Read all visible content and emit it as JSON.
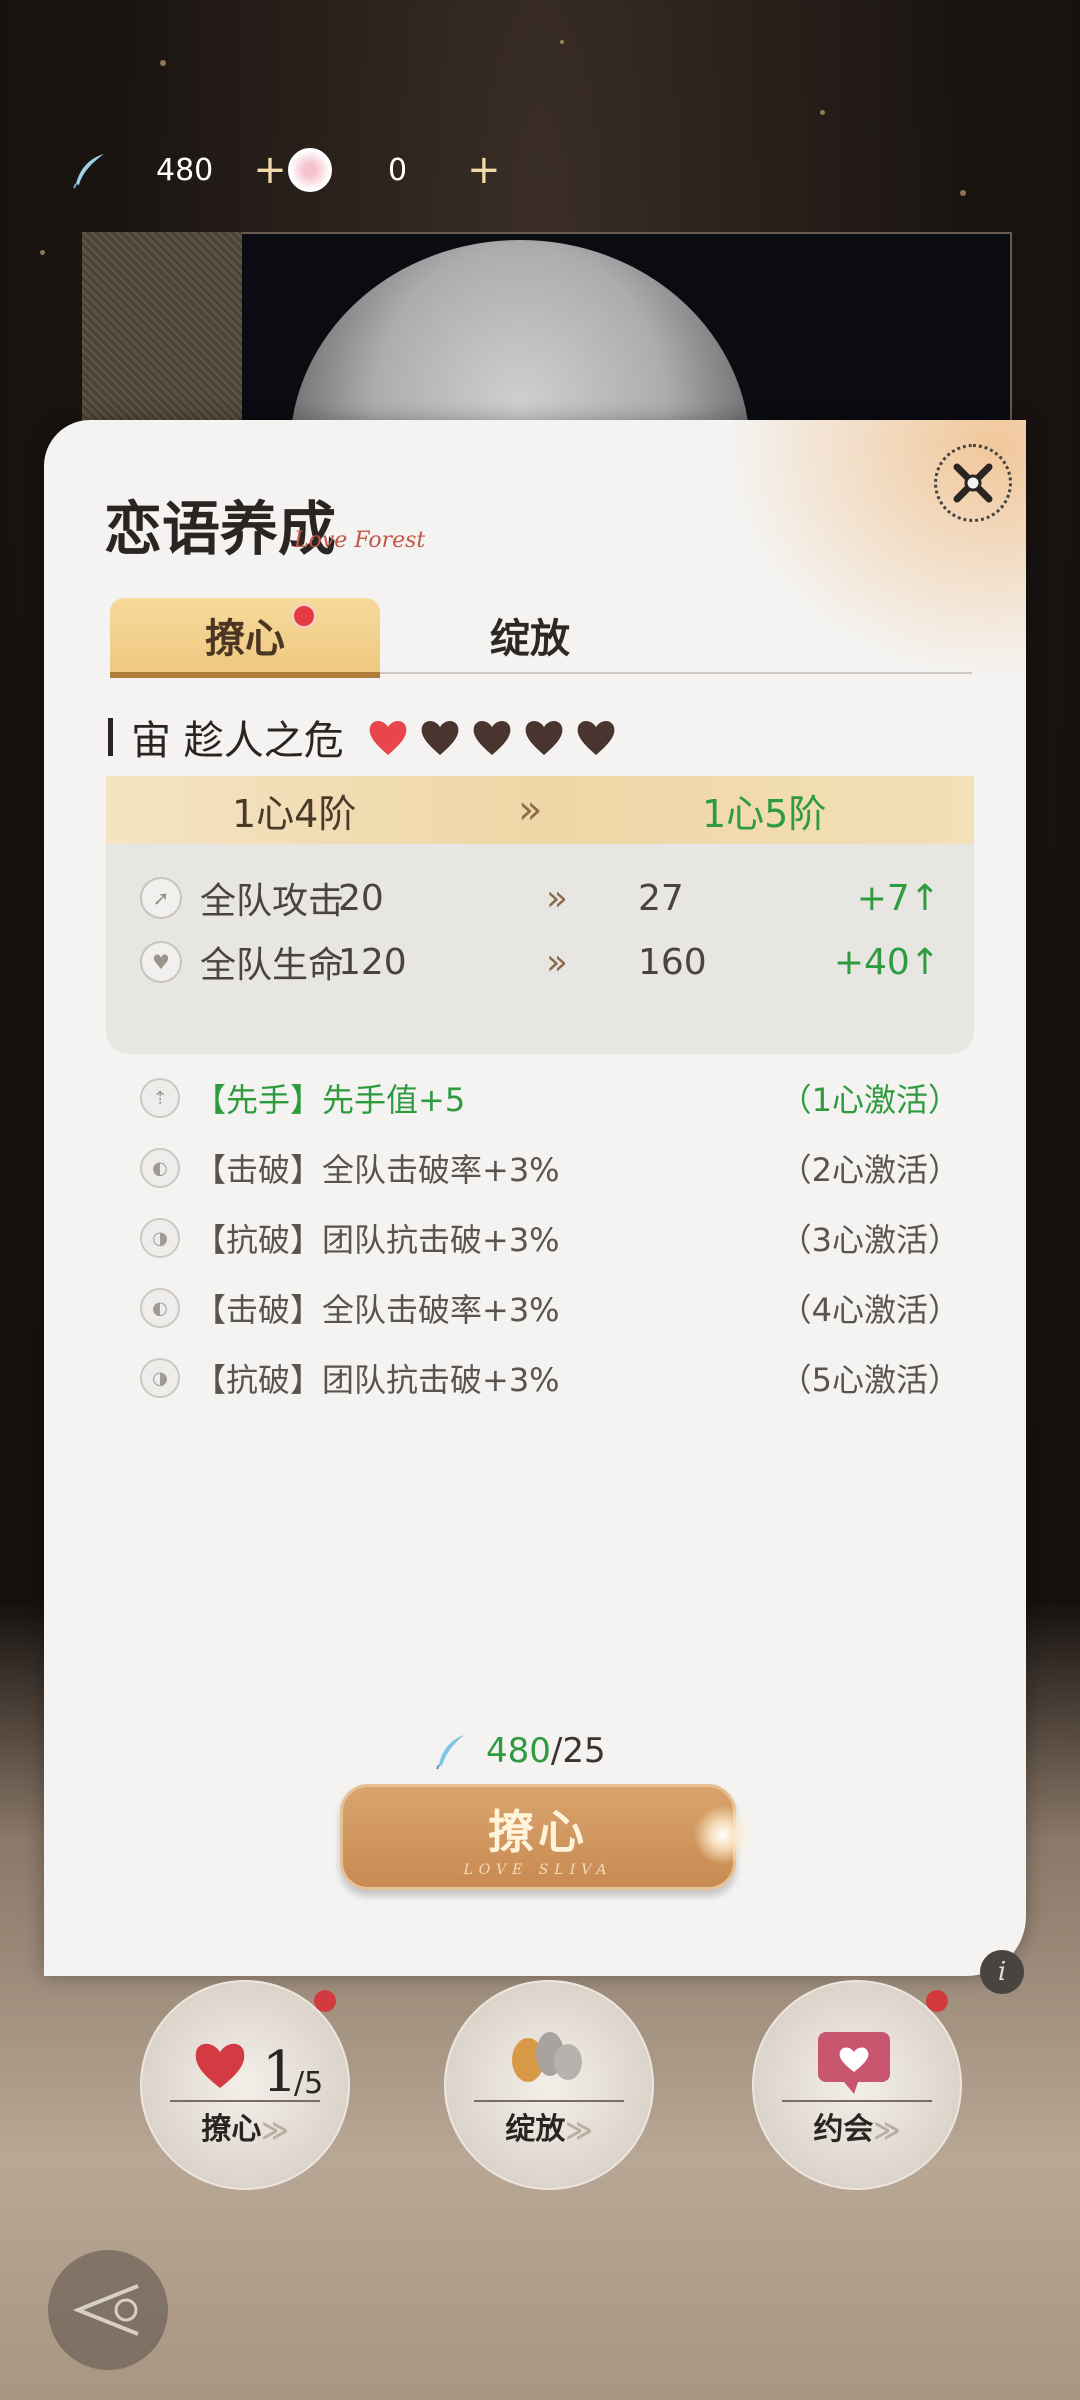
{
  "currency": {
    "feather_amount": "480",
    "rose_amount": "0",
    "plus": "+"
  },
  "panel": {
    "title": "恋语养成",
    "subtitle": "Love Forest",
    "tabs": [
      {
        "label": "撩心",
        "active": true,
        "badge": true
      },
      {
        "label": "绽放",
        "active": false,
        "badge": false
      }
    ]
  },
  "character": {
    "name": "宙 趁人之危",
    "hearts_filled": 1,
    "hearts_total": 5
  },
  "level": {
    "from": "1心4阶",
    "arrow": "»",
    "to": "1心5阶"
  },
  "stats": [
    {
      "label": "全队攻击",
      "from": "20",
      "arrow": "»",
      "to": "27",
      "delta": "+7↑"
    },
    {
      "label": "全队生命",
      "from": "120",
      "arrow": "»",
      "to": "160",
      "delta": "+40↑"
    }
  ],
  "skills": [
    {
      "text": "【先手】先手值+5",
      "condition": "（1心激活）",
      "active": true
    },
    {
      "text": "【击破】全队击破率+3%",
      "condition": "（2心激活）",
      "active": false
    },
    {
      "text": "【抗破】团队抗击破+3%",
      "condition": "（3心激活）",
      "active": false
    },
    {
      "text": "【击破】全队击破率+3%",
      "condition": "（4心激活）",
      "active": false
    },
    {
      "text": "【抗破】团队抗击破+3%",
      "condition": "（5心激活）",
      "active": false
    }
  ],
  "cost": {
    "have": "480",
    "need": "/25"
  },
  "action": {
    "label": "撩心",
    "sub": "LOVE SLIVA"
  },
  "info": "i",
  "bottom_nav": [
    {
      "label": "撩心",
      "count": "1",
      "total": "/5",
      "badge": true
    },
    {
      "label": "绽放",
      "badge": false
    },
    {
      "label": "约会",
      "badge": true
    }
  ],
  "chevrons": "≫",
  "colors": {
    "accent_green": "#2e9b3f",
    "tab_gold": "#efc880",
    "button_bronze": "#c88a52",
    "badge_red": "#e43b40"
  }
}
